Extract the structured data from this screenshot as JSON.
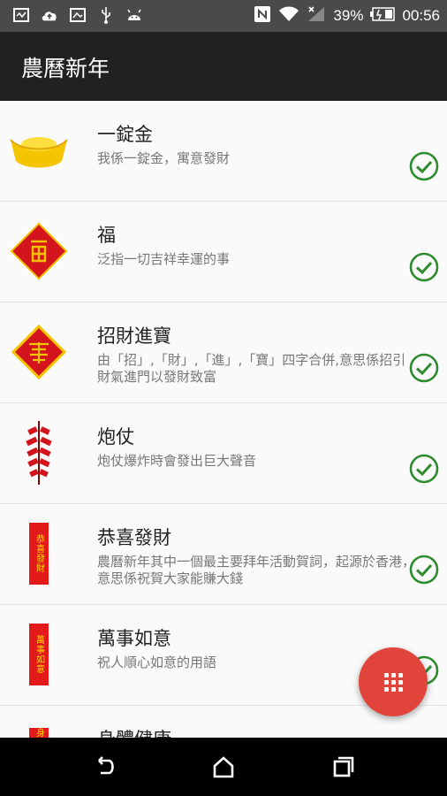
{
  "status_bar": {
    "battery_percent": "39%",
    "time": "00:56",
    "icons": [
      "screen-icon",
      "cloud-upload-icon",
      "image-icon",
      "usb-icon",
      "android-icon",
      "nfc-icon",
      "wifi-icon",
      "signal-icon",
      "battery-icon"
    ]
  },
  "app_bar": {
    "title": "農曆新年"
  },
  "list": {
    "items": [
      {
        "title": "一錠金",
        "description": "我係一錠金，寓意發財",
        "icon": "gold-ingot-icon"
      },
      {
        "title": "福",
        "description": "泛指一切吉祥幸運的事",
        "icon": "fu-diamond-icon"
      },
      {
        "title": "招財進寶",
        "description": "由「招」,「財」,「進」,「寶」四字合併,意思係招引財氣進門以發財致富",
        "icon": "zhaocai-diamond-icon"
      },
      {
        "title": "炮仗",
        "description": "炮仗爆炸時會發出巨大聲音",
        "icon": "firecracker-icon"
      },
      {
        "title": "恭喜發財",
        "description": "農曆新年其中一個最主要拜年活動賀詞，起源於香港，意思係祝賀大家能賺大錢",
        "icon": "banner-icon",
        "banner_text": "恭喜發財"
      },
      {
        "title": "萬事如意",
        "description": "祝人順心如意的用語",
        "icon": "banner-icon",
        "banner_text": "萬事如意"
      },
      {
        "title": "身體健康",
        "description": "",
        "icon": "banner-icon",
        "banner_text": "身體健康"
      }
    ]
  },
  "colors": {
    "check": "#2e8b2e",
    "fab": "#e0443a",
    "app_bar": "#212121",
    "status_bar": "#4a4a4a"
  }
}
